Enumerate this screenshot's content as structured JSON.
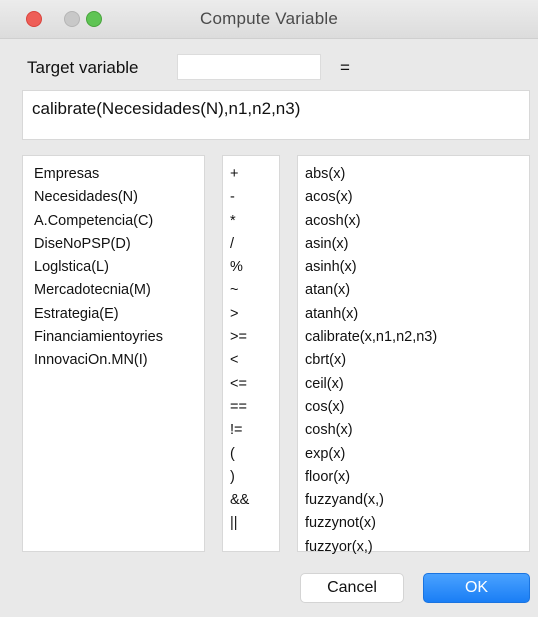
{
  "window": {
    "title": "Compute Variable"
  },
  "target": {
    "label": "Target variable",
    "value": "",
    "equals": "="
  },
  "expression": "calibrate(Necesidades(N),n1,n2,n3)",
  "variables": [
    "Empresas",
    "Necesidades(N)",
    "A.Competencia(C)",
    "DiseNoPSP(D)",
    "Loglstica(L)",
    "Mercadotecnia(M)",
    "Estrategia(E)",
    "Financiamientoyries",
    "InnovaciOn.MN(I)"
  ],
  "operators": [
    "+",
    "-",
    "*",
    "/",
    "%",
    "~",
    ">",
    ">=",
    "<",
    "<=",
    "==",
    "!=",
    "(",
    ")",
    "&&",
    "||"
  ],
  "functions": [
    "abs(x)",
    "acos(x)",
    "acosh(x)",
    "asin(x)",
    "asinh(x)",
    "atan(x)",
    "atanh(x)",
    "calibrate(x,n1,n2,n3)",
    "cbrt(x)",
    "ceil(x)",
    "cos(x)",
    "cosh(x)",
    "exp(x)",
    "floor(x)",
    "fuzzyand(x,)",
    "fuzzynot(x)",
    "fuzzyor(x,)"
  ],
  "buttons": {
    "cancel": "Cancel",
    "ok": "OK"
  }
}
